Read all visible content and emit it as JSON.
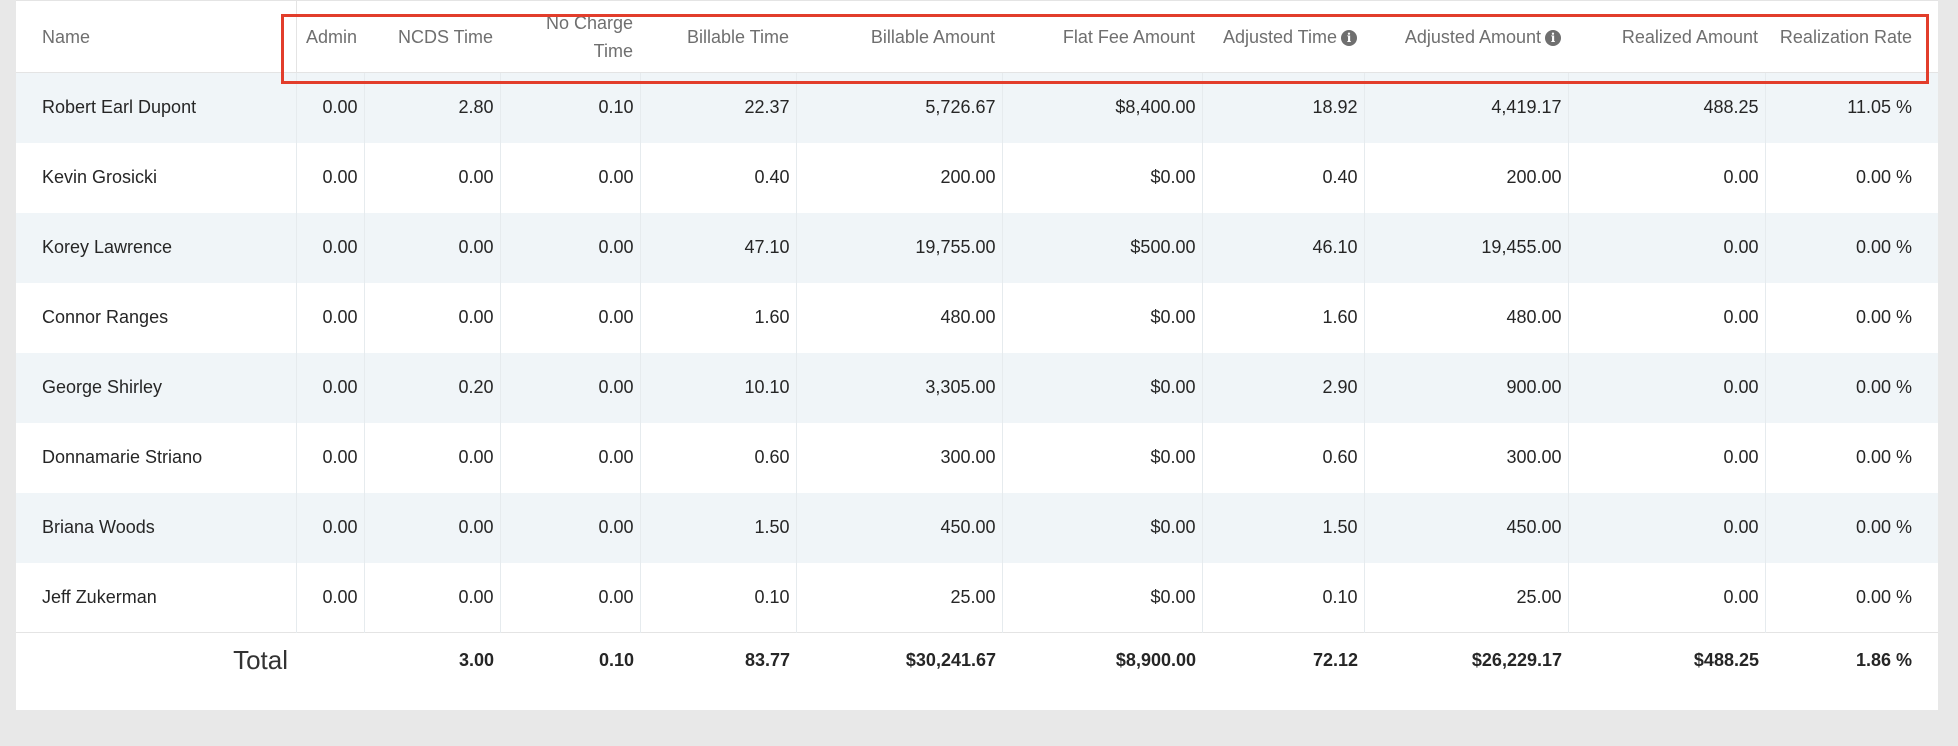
{
  "columns": [
    {
      "key": "name",
      "label": "Name"
    },
    {
      "key": "admin",
      "label": "Admin"
    },
    {
      "key": "ncds_time",
      "label": "NCDS Time"
    },
    {
      "key": "no_charge_time_line1",
      "label": "No Charge"
    },
    {
      "key": "no_charge_time_line2",
      "label": "Time"
    },
    {
      "key": "billable_time",
      "label": "Billable Time"
    },
    {
      "key": "billable_amount",
      "label": "Billable Amount"
    },
    {
      "key": "flat_fee_amount",
      "label": "Flat Fee Amount"
    },
    {
      "key": "adjusted_time",
      "label": "Adjusted Time"
    },
    {
      "key": "adjusted_amount",
      "label": "Adjusted Amount"
    },
    {
      "key": "realized_amount",
      "label": "Realized Amount"
    },
    {
      "key": "realization_rate",
      "label": "Realization Rate"
    }
  ],
  "info_icon": "info-circle-icon",
  "rows": [
    [
      "Robert Earl Dupont",
      "0.00",
      "2.80",
      "0.10",
      "22.37",
      "5,726.67",
      "$8,400.00",
      "18.92",
      "4,419.17",
      "488.25",
      "11.05 %"
    ],
    [
      "Kevin Grosicki",
      "0.00",
      "0.00",
      "0.00",
      "0.40",
      "200.00",
      "$0.00",
      "0.40",
      "200.00",
      "0.00",
      "0.00 %"
    ],
    [
      "Korey Lawrence",
      "0.00",
      "0.00",
      "0.00",
      "47.10",
      "19,755.00",
      "$500.00",
      "46.10",
      "19,455.00",
      "0.00",
      "0.00 %"
    ],
    [
      "Connor Ranges",
      "0.00",
      "0.00",
      "0.00",
      "1.60",
      "480.00",
      "$0.00",
      "1.60",
      "480.00",
      "0.00",
      "0.00 %"
    ],
    [
      "George Shirley",
      "0.00",
      "0.20",
      "0.00",
      "10.10",
      "3,305.00",
      "$0.00",
      "2.90",
      "900.00",
      "0.00",
      "0.00 %"
    ],
    [
      "Donnamarie Striano",
      "0.00",
      "0.00",
      "0.00",
      "0.60",
      "300.00",
      "$0.00",
      "0.60",
      "300.00",
      "0.00",
      "0.00 %"
    ],
    [
      "Briana Woods",
      "0.00",
      "0.00",
      "0.00",
      "1.50",
      "450.00",
      "$0.00",
      "1.50",
      "450.00",
      "0.00",
      "0.00 %"
    ],
    [
      "Jeff Zukerman",
      "0.00",
      "0.00",
      "0.00",
      "0.10",
      "25.00",
      "$0.00",
      "0.10",
      "25.00",
      "0.00",
      "0.00 %"
    ]
  ],
  "totals": {
    "label": "Total",
    "admin": "",
    "ncds_time": "3.00",
    "no_charge_time": "0.10",
    "billable_time": "83.77",
    "billable_amount": "$30,241.67",
    "flat_fee_amount": "$8,900.00",
    "adjusted_time": "72.12",
    "adjusted_amount": "$26,229.17",
    "realized_amount": "$488.25",
    "realization_rate": "1.86 %"
  },
  "colors": {
    "highlight_border": "#e23d2b",
    "row_stripe": "#f0f5f8"
  }
}
